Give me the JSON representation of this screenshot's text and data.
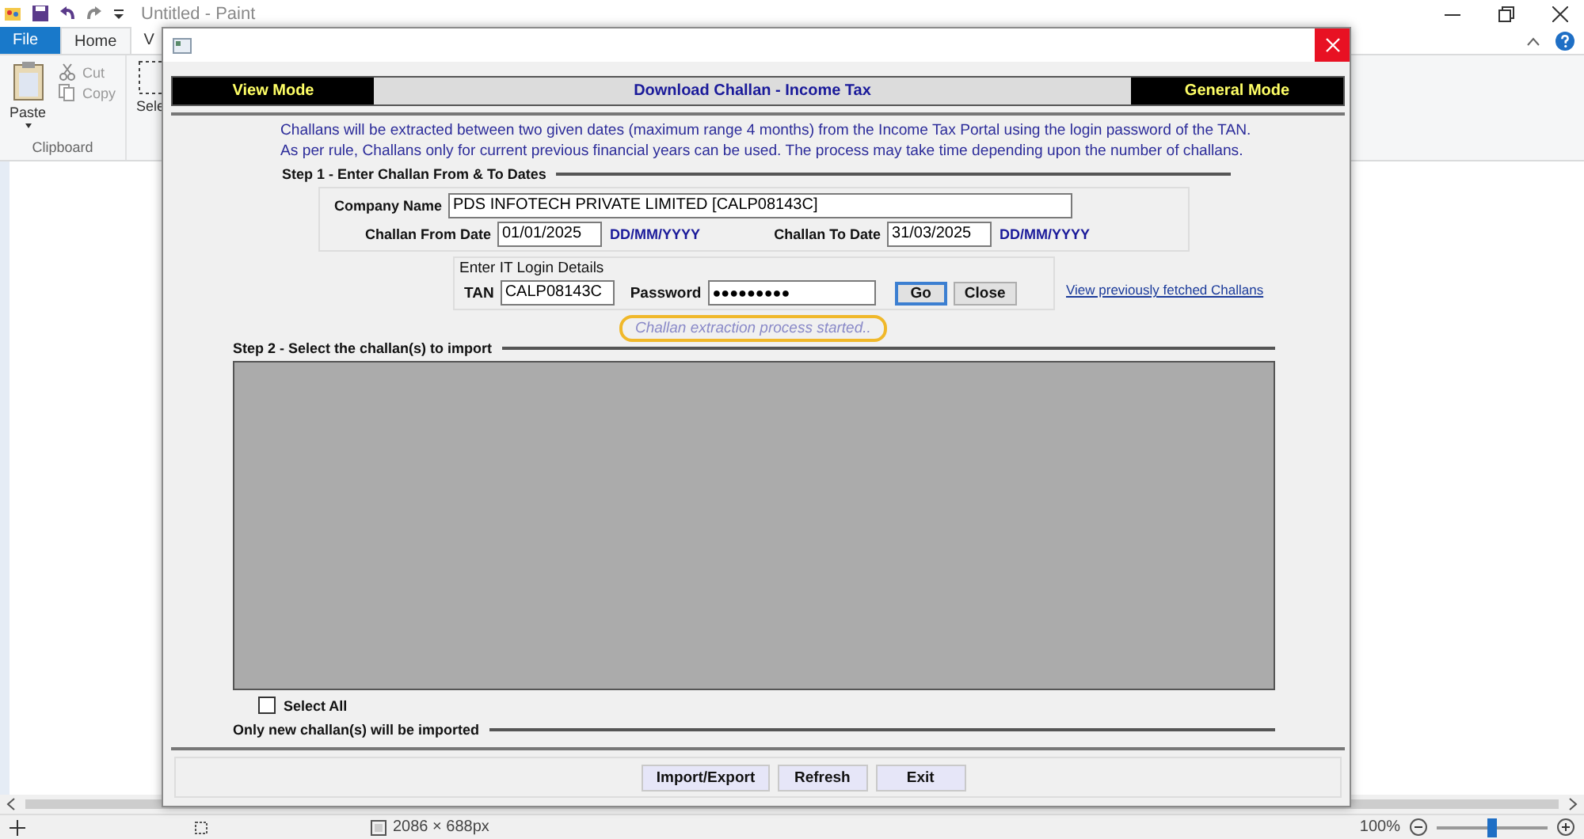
{
  "paint": {
    "title": "Untitled - Paint",
    "tabs": [
      {
        "label": "File",
        "selected": false,
        "kind": "file"
      },
      {
        "label": "Home",
        "selected": true,
        "kind": "tab"
      },
      {
        "label": "V",
        "selected": false,
        "kind": "tab"
      }
    ],
    "clipboard": {
      "paste": "Paste",
      "cut": "Cut",
      "copy": "Copy",
      "group": "Clipboard"
    },
    "select": "Sele",
    "status": {
      "size": "2086 × 688px",
      "zoom": "100%",
      "level": 0.5
    }
  },
  "dialog": {
    "header": {
      "left": "View Mode",
      "title": "Download Challan - Income Tax",
      "right": "General Mode"
    },
    "description": "Challans will be extracted between two given dates (maximum range 4 months) from the Income Tax Portal using the login password of the TAN. As per rule, Challans only for current  previous financial years can be used. The process may take time depending upon the number of challans.",
    "step1": {
      "heading": "Step 1 - Enter Challan From & To Dates",
      "company_label": "Company Name",
      "company_value": "PDS INFOTECH PRIVATE LIMITED [CALP08143C]",
      "from_label": "Challan From Date",
      "from_value": "01/01/2025",
      "from_format": "DD/MM/YYYY",
      "to_label": "Challan To Date",
      "to_value": "31/03/2025",
      "to_format": "DD/MM/YYYY"
    },
    "login": {
      "heading": "Enter IT Login Details",
      "tan_label": "TAN",
      "tan_value": "CALP08143C",
      "password_label": "Password",
      "password_value": "●●●●●●●●●",
      "buttons": [
        {
          "label": "Go",
          "focused": true
        },
        {
          "label": "Close",
          "focused": false
        }
      ]
    },
    "link": "View previously fetched Challans",
    "status_message": "Challan extraction process started..",
    "step2": {
      "heading": "Step 2 - Select the challan(s) to import"
    },
    "select_all": {
      "label": "Select All",
      "checked": false
    },
    "note": "Only new challan(s) will be imported",
    "buttons": [
      "Import/Export",
      "Refresh",
      "Exit"
    ]
  }
}
